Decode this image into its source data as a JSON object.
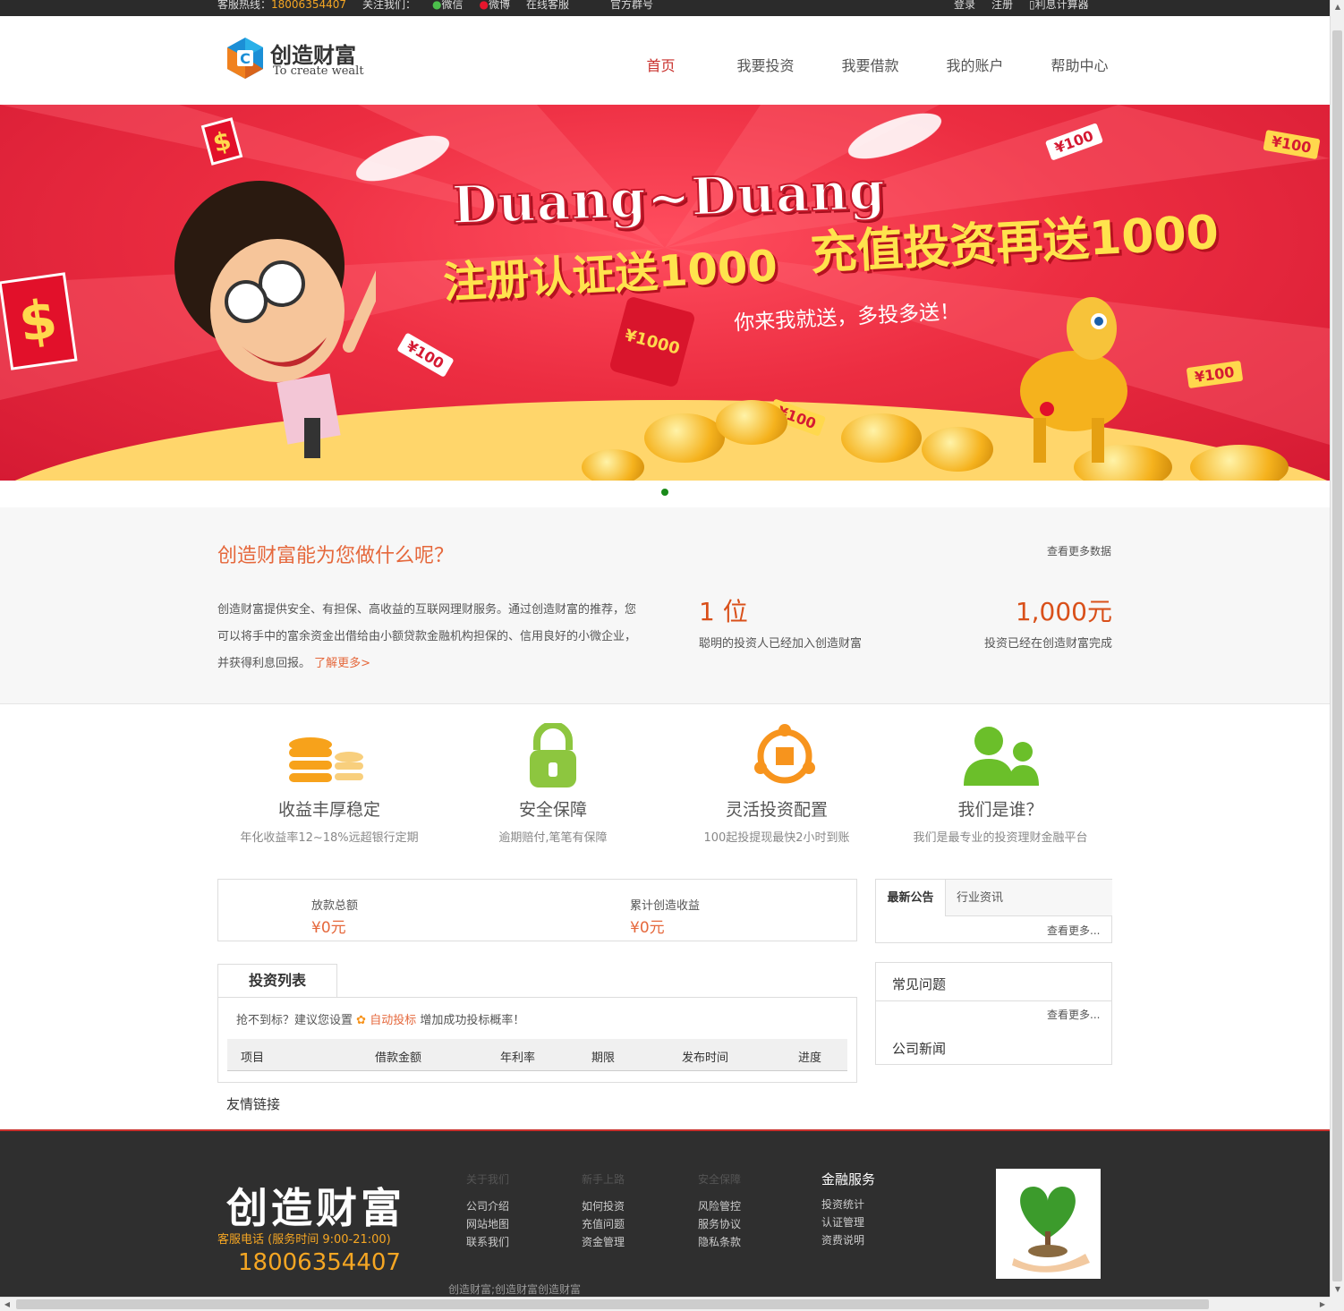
{
  "topbar": {
    "hotline_label": "客服热线：",
    "hotline_number": "18006354407",
    "follow_label": "关注我们：",
    "wechat": "微信",
    "weibo": "微博",
    "online_service": "在线客服",
    "official_account": "官方群号",
    "login": "登录",
    "register": "注册",
    "calculator": "利息计算器"
  },
  "logo": {
    "cn": "创造财富",
    "en": "To create wealt"
  },
  "nav": {
    "items": [
      {
        "label": "首页",
        "active": true
      },
      {
        "label": "我要投资",
        "active": false
      },
      {
        "label": "我要借款",
        "active": false
      },
      {
        "label": "我的账户",
        "active": false
      },
      {
        "label": "帮助中心",
        "active": false
      }
    ]
  },
  "banner": {
    "headline": "Duang~Duang",
    "offer_left": "注册认证送1000",
    "offer_right": "充值投资再送1000",
    "slogan": "你来我就送，多投多送！",
    "tags": [
      "¥100",
      "¥100",
      "¥100",
      "¥100",
      "¥100",
      "¥1000"
    ],
    "dollar": "$"
  },
  "intro": {
    "question": "创造财富能为您做什么呢？",
    "more_data": "查看更多数据",
    "description": "创造财富提供安全、有担保、高收益的互联网理财服务。通过创造财富的推荐，您可以将手中的富余资金出借给由小额贷款金融机构担保的、信用良好的小微企业，并获得利息回报。",
    "learn_more": "了解更多>",
    "stat_investors_value": "1 位",
    "stat_investors_label": "聪明的投资人已经加入创造财富",
    "stat_amount_value": "1,000元",
    "stat_amount_label": "投资已经在创造财富完成"
  },
  "features": [
    {
      "icon": "coins-icon",
      "title": "收益丰厚稳定",
      "sub": "年化收益率12~18%远超银行定期"
    },
    {
      "icon": "lock-icon",
      "title": "安全保障",
      "sub": "逾期赔付,笔笔有保障"
    },
    {
      "icon": "network-icon",
      "title": "灵活投资配置",
      "sub": "100起投提现最快2小时到账"
    },
    {
      "icon": "people-icon",
      "title": "我们是谁？",
      "sub": "我们是最专业的投资理财金融平台"
    }
  ],
  "totals": {
    "loan_label": "放款总额",
    "loan_value": "¥0元",
    "income_label": "累计创造收益",
    "income_value": "¥0元"
  },
  "news": {
    "tab_announcements": "最新公告",
    "tab_industry": "行业资讯",
    "more": "查看更多..."
  },
  "invest_list": {
    "tab": "投资列表",
    "tip_prefix": "抢不到标？建议您设置",
    "tip_auto": "自动投标",
    "tip_suffix": "增加成功投标概率！",
    "columns": [
      "项目",
      "借款金额",
      "年利率",
      "期限",
      "发布时间",
      "进度"
    ]
  },
  "faq": {
    "title": "常见问题",
    "more": "查看更多...",
    "company_news": "公司新闻"
  },
  "friend_links": "友情链接",
  "footer": {
    "brand": "创造财富",
    "hotline_label": "客服电话 (服务时间 9:00-21:00)",
    "hotline": "18006354407",
    "columns": [
      {
        "title": "关于我们",
        "items": [
          "公司介绍",
          "网站地图",
          "联系我们"
        ]
      },
      {
        "title": "新手上路",
        "items": [
          "如何投资",
          "充值问题",
          "资金管理"
        ]
      },
      {
        "title": "安全保障",
        "items": [
          "风险管控",
          "服务协议",
          "隐私条款"
        ]
      },
      {
        "title": "金融服务",
        "items": [
          "投资统计",
          "认证管理",
          "资费说明"
        ]
      }
    ],
    "copyright": "创造财富;创造财富创造财富"
  },
  "colors": {
    "accent": "#e5683c",
    "nav_active": "#c9302c",
    "footer_bg": "#2f2f2f",
    "hotline": "#f5a623"
  }
}
